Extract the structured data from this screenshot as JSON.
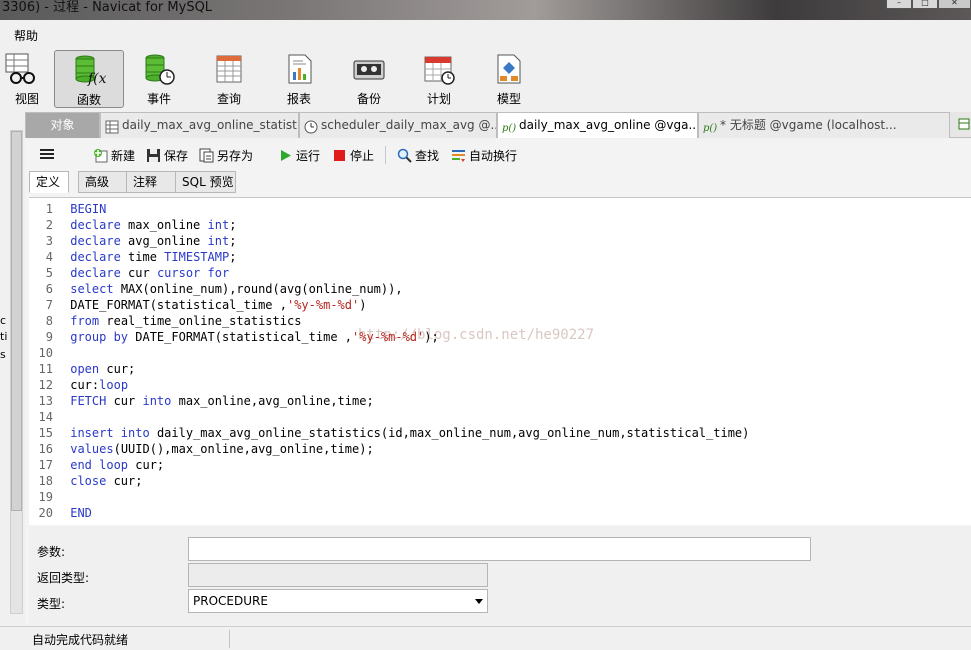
{
  "window": {
    "title": "3306) - 过程 - Navicat for MySQL"
  },
  "menu": {
    "items": [
      "帮助"
    ]
  },
  "ribbon": {
    "items": [
      {
        "label": "视图",
        "icon": "glasses-icon"
      },
      {
        "label": "函数",
        "icon": "function-icon",
        "active": true
      },
      {
        "label": "事件",
        "icon": "event-icon"
      },
      {
        "label": "查询",
        "icon": "query-icon"
      },
      {
        "label": "报表",
        "icon": "report-icon"
      },
      {
        "label": "备份",
        "icon": "backup-icon"
      },
      {
        "label": "计划",
        "icon": "schedule-icon"
      },
      {
        "label": "模型",
        "icon": "model-icon"
      }
    ]
  },
  "tabs": [
    {
      "label": "对象"
    },
    {
      "label": "daily_max_avg_online_statist..."
    },
    {
      "label": "scheduler_daily_max_avg @..."
    },
    {
      "label": "daily_max_avg_online @vga..."
    },
    {
      "label": "* 无标题 @vgame (localhost..."
    }
  ],
  "toolbar": {
    "new": "新建",
    "save": "保存",
    "save_as": "另存为",
    "run": "运行",
    "stop": "停止",
    "find": "查找",
    "wrap": "自动换行"
  },
  "subtabs": [
    "定义",
    "高级",
    "注释",
    "SQL 预览"
  ],
  "code": {
    "lines": [
      [
        [
          "kw",
          "BEGIN"
        ]
      ],
      [
        [
          "kw",
          "declare"
        ],
        [
          "t",
          " max_online "
        ],
        [
          "kw",
          "int"
        ],
        [
          "t",
          ";"
        ]
      ],
      [
        [
          "kw",
          "declare"
        ],
        [
          "t",
          " avg_online "
        ],
        [
          "kw",
          "int"
        ],
        [
          "t",
          ";"
        ]
      ],
      [
        [
          "kw",
          "declare"
        ],
        [
          "t",
          " time "
        ],
        [
          "kw",
          "TIMESTAMP"
        ],
        [
          "t",
          ";"
        ]
      ],
      [
        [
          "kw",
          "declare"
        ],
        [
          "t",
          " cur "
        ],
        [
          "kw",
          "cursor"
        ],
        [
          "t",
          " "
        ],
        [
          "kw",
          "for"
        ]
      ],
      [
        [
          "kw",
          "select"
        ],
        [
          "t",
          " MAX(online_num),round(avg(online_num)),"
        ]
      ],
      [
        [
          "t",
          "DATE_FORMAT(statistical_time ,"
        ],
        [
          "str",
          "'%y-%m-%d'"
        ],
        [
          "t",
          ")"
        ]
      ],
      [
        [
          "kw",
          "from"
        ],
        [
          "t",
          " real_time_online_statistics"
        ]
      ],
      [
        [
          "kw",
          "group by"
        ],
        [
          "t",
          " DATE_FORMAT(statistical_time ,"
        ],
        [
          "str",
          "'%y-%m-%d'"
        ],
        [
          "t",
          ");"
        ]
      ],
      [],
      [
        [
          "kw",
          "open"
        ],
        [
          "t",
          " cur;"
        ]
      ],
      [
        [
          "t",
          "cur:"
        ],
        [
          "kw",
          "loop"
        ]
      ],
      [
        [
          "kw",
          "FETCH"
        ],
        [
          "t",
          " cur "
        ],
        [
          "kw",
          "into"
        ],
        [
          "t",
          " max_online,avg_online,time;"
        ]
      ],
      [],
      [
        [
          "kw",
          "insert into"
        ],
        [
          "t",
          " daily_max_avg_online_statistics(id,max_online_num,avg_online_num,statistical_time)"
        ]
      ],
      [
        [
          "kw",
          "values"
        ],
        [
          "t",
          "(UUID(),max_online,avg_online,time);"
        ]
      ],
      [
        [
          "kw",
          "end loop"
        ],
        [
          "t",
          " cur;"
        ]
      ],
      [
        [
          "kw",
          "close"
        ],
        [
          "t",
          " cur;"
        ]
      ],
      [],
      [
        [
          "kw",
          "END"
        ]
      ]
    ],
    "watermark": "http://blog.csdn.net/he90227"
  },
  "form": {
    "params_label": "参数:",
    "params_value": "",
    "return_label": "返回类型:",
    "return_value": "",
    "type_label": "类型:",
    "type_value": "PROCEDURE"
  },
  "left_strip": [
    "c",
    "ti",
    "s"
  ],
  "status": {
    "text": "自动完成代码就绪"
  }
}
